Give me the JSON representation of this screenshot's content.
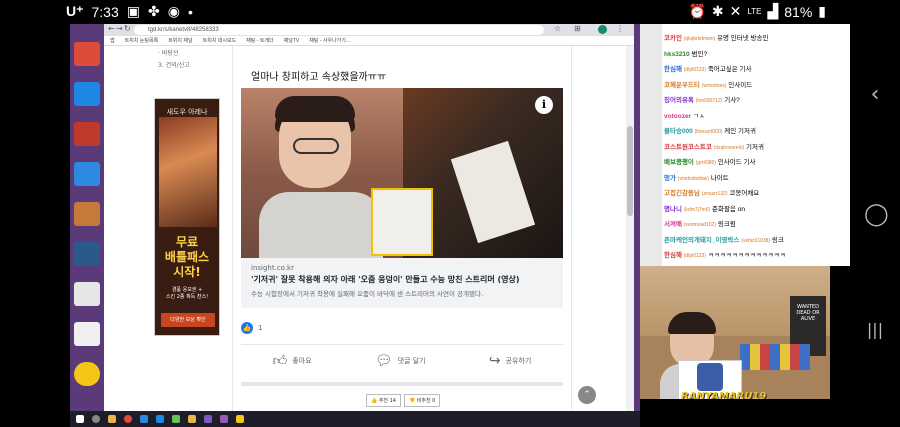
{
  "status_bar": {
    "carrier": "U⁺",
    "time": "7:33",
    "network": "LTE",
    "battery": "81%"
  },
  "browser": {
    "url": "tgd.kr/s/kanetv8/48258333",
    "bookmarks": [
      "앱",
      "트위치 눈팅목록",
      "트위치 채널",
      "트위치 대시보드",
      "채팅 - 트게더",
      "채널TV",
      "채팅 - 사우나가기..."
    ]
  },
  "side_menu": {
    "items": [
      "· 바탕선",
      "3. 건의/신고"
    ]
  },
  "ad": {
    "top": "새도우 아레나",
    "main": "무료\n배틀패스\n시작!",
    "sub": "경품 응모권 +\n스킨 2종 획득 찬스!",
    "button": "다양한 보상 확인"
  },
  "post": {
    "text": "얼마나 창피하고 속상했을까ㅠㅠ",
    "link_domain": "insight.co.kr",
    "link_title": "'기저귀' 잘못 착용해 의자 아래 '오줌 웅덩이' 만들고 수능 망친 스트리머 (영상)",
    "link_desc": "수능 시험장에서 기저귀 착용에 실패해 오줌이 바닥에 샌 스트리머의 사연이 공개됐다.",
    "like_count": "1",
    "actions": {
      "like": "좋아요",
      "comment": "댓글 달기",
      "share": "공유하기"
    },
    "pager": [
      "👍 추천 14",
      "👎 비추천 0"
    ]
  },
  "chat": {
    "lines": [
      {
        "nick": "코카인",
        "id": "(qkqkrkdmwn)",
        "text": "유명 인터넷 방송인"
      },
      {
        "nick": "hks3210",
        "id": "",
        "text": "범인?"
      },
      {
        "nick": "한심해",
        "id": "(dlpl0123)",
        "text": "죽어고싶은 기사"
      },
      {
        "nick": "코헤운우드티",
        "id": "(wmodnes)",
        "text": "인사이드"
      },
      {
        "nick": "징어의유혹",
        "id": "(km090712)",
        "text": "기사?"
      },
      {
        "nick": "votoozer",
        "id": "",
        "text": "ㄱㅅ"
      },
      {
        "nick": "블타승000",
        "id": "(ltooszrt000)",
        "text": "케인 기저귀"
      },
      {
        "nick": "코스트원코스트코",
        "id": "(dzqknnerelo)",
        "text": "기저귀"
      },
      {
        "nick": "배보콩팽이",
        "id": "(grt4385)",
        "text": "인사이드 기사"
      },
      {
        "nick": "멍가",
        "id": "(vmdoidotlaw)",
        "text": "나이트"
      },
      {
        "nick": "고접긴감동님",
        "id": "(znoarr132)",
        "text": "코봉어채요"
      },
      {
        "nick": "명나니",
        "id": "(kdm7j7m6)",
        "text": "준화팔음 on"
      },
      {
        "nick": "서져배",
        "id": "(seomoad102)",
        "text": "링크펌"
      },
      {
        "nick": "존마케언의개돼지_이영박스",
        "id": "(vehic01038)",
        "text": "링크"
      },
      {
        "nick": "한심해",
        "id": "(dlpl0123)",
        "text": "ㅋㅋㅋㅋㅋㅋㅋㅋㅋㅋㅋㅋㅋ"
      }
    ]
  },
  "webcam": {
    "poster_text": "WANTED\nDEAD OR ALIVE",
    "avatar_name": "RANYAMARU19"
  },
  "nav": {
    "back": "‹",
    "home": "◯",
    "recents": "|||"
  }
}
